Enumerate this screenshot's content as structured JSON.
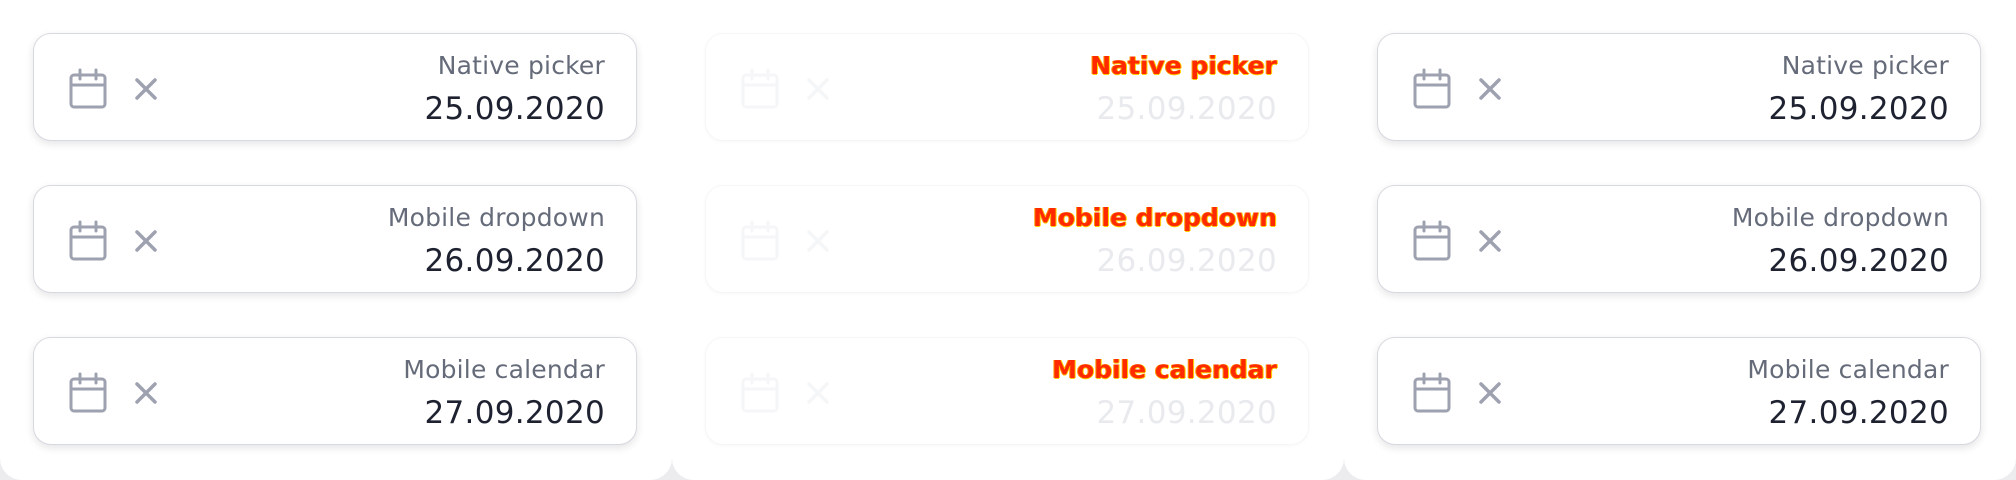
{
  "colors": {
    "background": "#ececef",
    "panel": "#ffffff",
    "border": "#d7d9e0",
    "label": "#656b79",
    "value": "#1e2230",
    "icon": "#9ea2b0",
    "ghost_label": "#ff2a00"
  },
  "columns": [
    {
      "pickers": [
        {
          "label": "Native picker",
          "value": "25.09.2020",
          "icons": [
            "calendar-icon",
            "close-icon"
          ]
        },
        {
          "label": "Mobile dropdown",
          "value": "26.09.2020",
          "icons": [
            "calendar-icon",
            "close-icon"
          ]
        },
        {
          "label": "Mobile calendar",
          "value": "27.09.2020",
          "icons": [
            "calendar-icon",
            "close-icon"
          ]
        }
      ]
    },
    {
      "pickers": [
        {
          "label": "Native picker",
          "value": "25.09.2020",
          "icons": [
            "calendar-icon",
            "close-icon"
          ]
        },
        {
          "label": "Mobile dropdown",
          "value": "26.09.2020",
          "icons": [
            "calendar-icon",
            "close-icon"
          ]
        },
        {
          "label": "Mobile calendar",
          "value": "27.09.2020",
          "icons": [
            "calendar-icon",
            "close-icon"
          ]
        }
      ]
    },
    {
      "pickers": [
        {
          "label": "Native picker",
          "value": "25.09.2020",
          "icons": [
            "calendar-icon",
            "close-icon"
          ]
        },
        {
          "label": "Mobile dropdown",
          "value": "26.09.2020",
          "icons": [
            "calendar-icon",
            "close-icon"
          ]
        },
        {
          "label": "Mobile calendar",
          "value": "27.09.2020",
          "icons": [
            "calendar-icon",
            "close-icon"
          ]
        }
      ]
    }
  ]
}
